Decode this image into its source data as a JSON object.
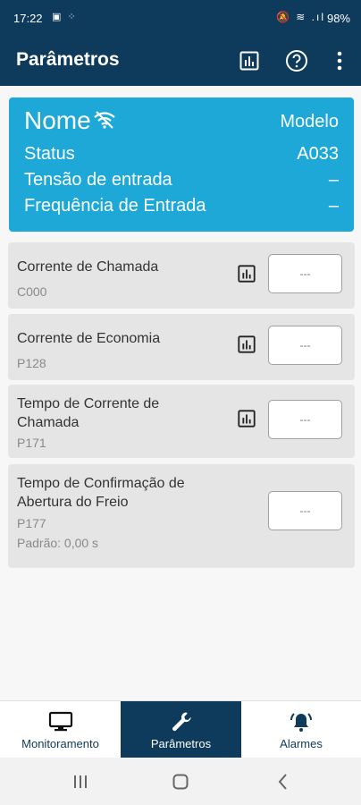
{
  "status_bar": {
    "time": "17:22",
    "battery": "98%",
    "left_icons": "▣ ⁘",
    "right_icons": "🔕 ≋ .ıl"
  },
  "app_bar": {
    "title": "Parâmetros",
    "icons": [
      "chart-icon",
      "help-icon",
      "more-icon"
    ]
  },
  "device": {
    "name": "Nome",
    "model_label": "Modelo",
    "status_label": "Status",
    "status_value": "A033",
    "input_voltage_label": "Tensão de entrada",
    "input_voltage_value": "–",
    "input_frequency_label": "Frequência de Entrada",
    "input_frequency_value": "–"
  },
  "parameters": [
    {
      "name": "Corrente de Chamada",
      "code": "C000",
      "value": "---"
    },
    {
      "name": "Corrente de Economia",
      "code": "P128",
      "value": "---"
    },
    {
      "name": "Tempo de Corrente de Chamada",
      "code": "P171",
      "value": "---"
    },
    {
      "name": "Tempo de Confirmação de Abertura do Freio",
      "code": "P177",
      "default": "Padrão: 0,00 s",
      "value": "---"
    }
  ],
  "bottom_nav": {
    "items": [
      {
        "label": "Monitoramento",
        "icon": "monitor-icon"
      },
      {
        "label": "Parâmetros",
        "icon": "wrench-icon",
        "active": true
      },
      {
        "label": "Alarmes",
        "icon": "alarm-icon"
      }
    ]
  },
  "colors": {
    "primary": "#0e3a5b",
    "header_card": "#1ea8d8",
    "card_bg": "#e5e5e5"
  }
}
